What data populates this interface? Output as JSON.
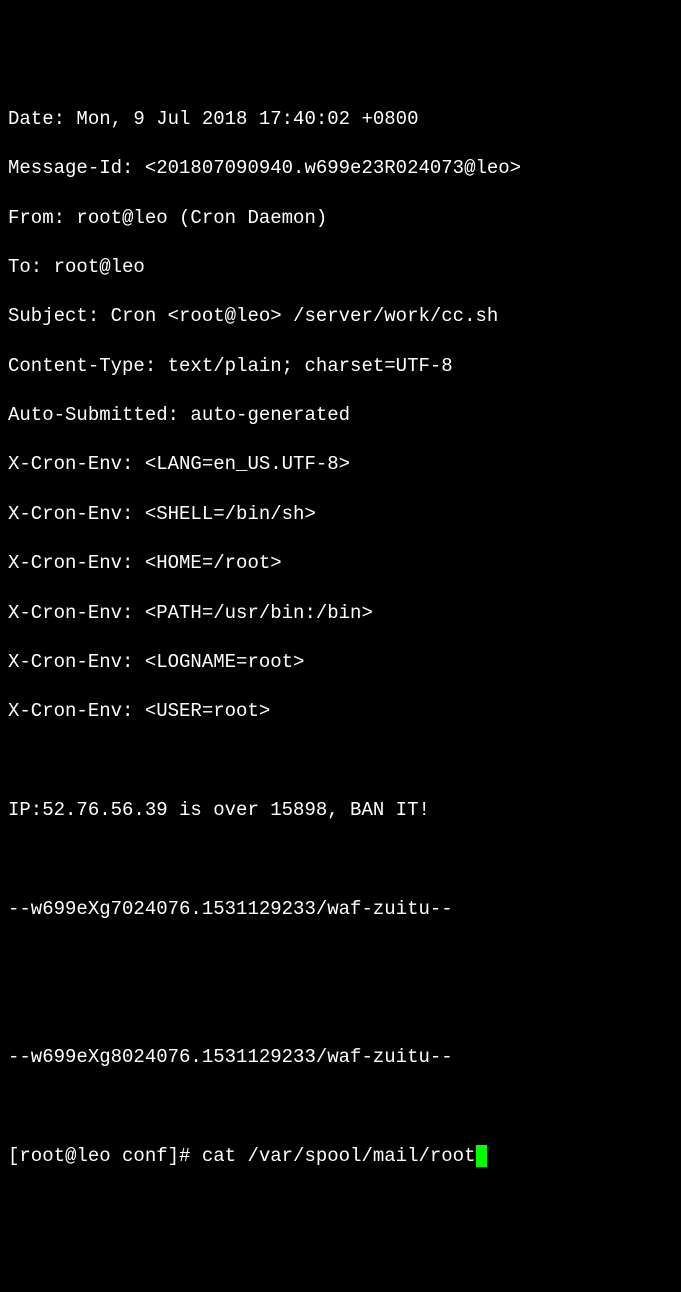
{
  "mail_headers": {
    "date": "Date: Mon, 9 Jul 2018 17:40:02 +0800",
    "message_id": "Message-Id: <201807090940.w699e23R024073@leo>",
    "from": "From: root@leo (Cron Daemon)",
    "to": "To: root@leo",
    "subject": "Subject: Cron <root@leo> /server/work/cc.sh",
    "content_type": "Content-Type: text/plain; charset=UTF-8",
    "auto_submitted": "Auto-Submitted: auto-generated",
    "env_lang": "X-Cron-Env: <LANG=en_US.UTF-8>",
    "env_shell": "X-Cron-Env: <SHELL=/bin/sh>",
    "env_home": "X-Cron-Env: <HOME=/root>",
    "env_path": "X-Cron-Env: <PATH=/usr/bin:/bin>",
    "env_logname": "X-Cron-Env: <LOGNAME=root>",
    "env_user": "X-Cron-Env: <USER=root>"
  },
  "mail_body": {
    "ip_warning": "IP:52.76.56.39 is over 15898, BAN IT!",
    "boundary1": "--w699eXg7024076.1531129233/waf-zuitu--",
    "boundary2": "--w699eXg8024076.1531129233/waf-zuitu--"
  },
  "prompt": {
    "text": "[root@leo conf]# ",
    "command": "cat /var/spool/mail/root"
  }
}
